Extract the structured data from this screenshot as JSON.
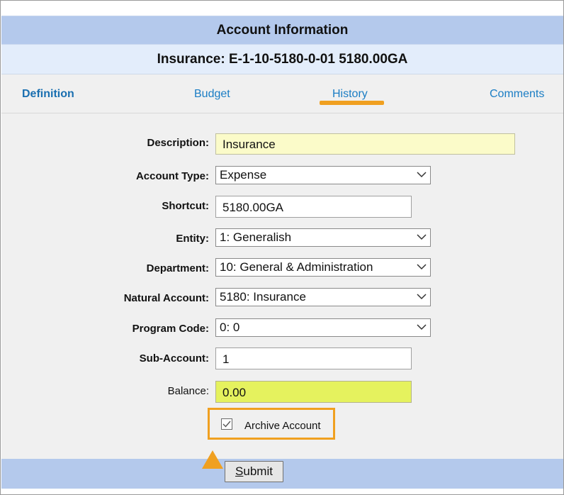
{
  "header": {
    "title": "Account Information",
    "subtitle": "Insurance: E-1-10-5180-0-01 5180.00GA"
  },
  "tabs": [
    {
      "label": "Definition",
      "active": true
    },
    {
      "label": "Budget",
      "active": false
    },
    {
      "label": "History",
      "active": false
    },
    {
      "label": "Comments",
      "active": false
    }
  ],
  "form": {
    "description": {
      "label": "Description:",
      "value": "Insurance"
    },
    "account_type": {
      "label": "Account Type:",
      "value": "Expense"
    },
    "shortcut": {
      "label": "Shortcut:",
      "value": "5180.00GA"
    },
    "entity": {
      "label": "Entity:",
      "value": "1: Generalish"
    },
    "department": {
      "label": "Department:",
      "value": "10: General & Administration"
    },
    "natural_account": {
      "label": "Natural Account:",
      "value": "5180: Insurance"
    },
    "program_code": {
      "label": "Program Code:",
      "value": "0: 0"
    },
    "sub_account": {
      "label": "Sub-Account:",
      "value": "1"
    },
    "balance": {
      "label": "Balance:",
      "value": "0.00"
    },
    "archive": {
      "label": "Archive Account",
      "checked": true
    }
  },
  "submit": {
    "label_underlined": "S",
    "label_rest": "ubmit"
  },
  "colors": {
    "header_bg": "#b4c9ec",
    "subheader_bg": "#e3edfb",
    "tab_link": "#1a7dc4",
    "highlight": "#f0a020",
    "description_bg": "#fbfbc9",
    "balance_bg": "#e5f25e"
  },
  "icons": {
    "dropdown": "chevron-down-icon",
    "pointer": "orange-arrow-icon"
  }
}
